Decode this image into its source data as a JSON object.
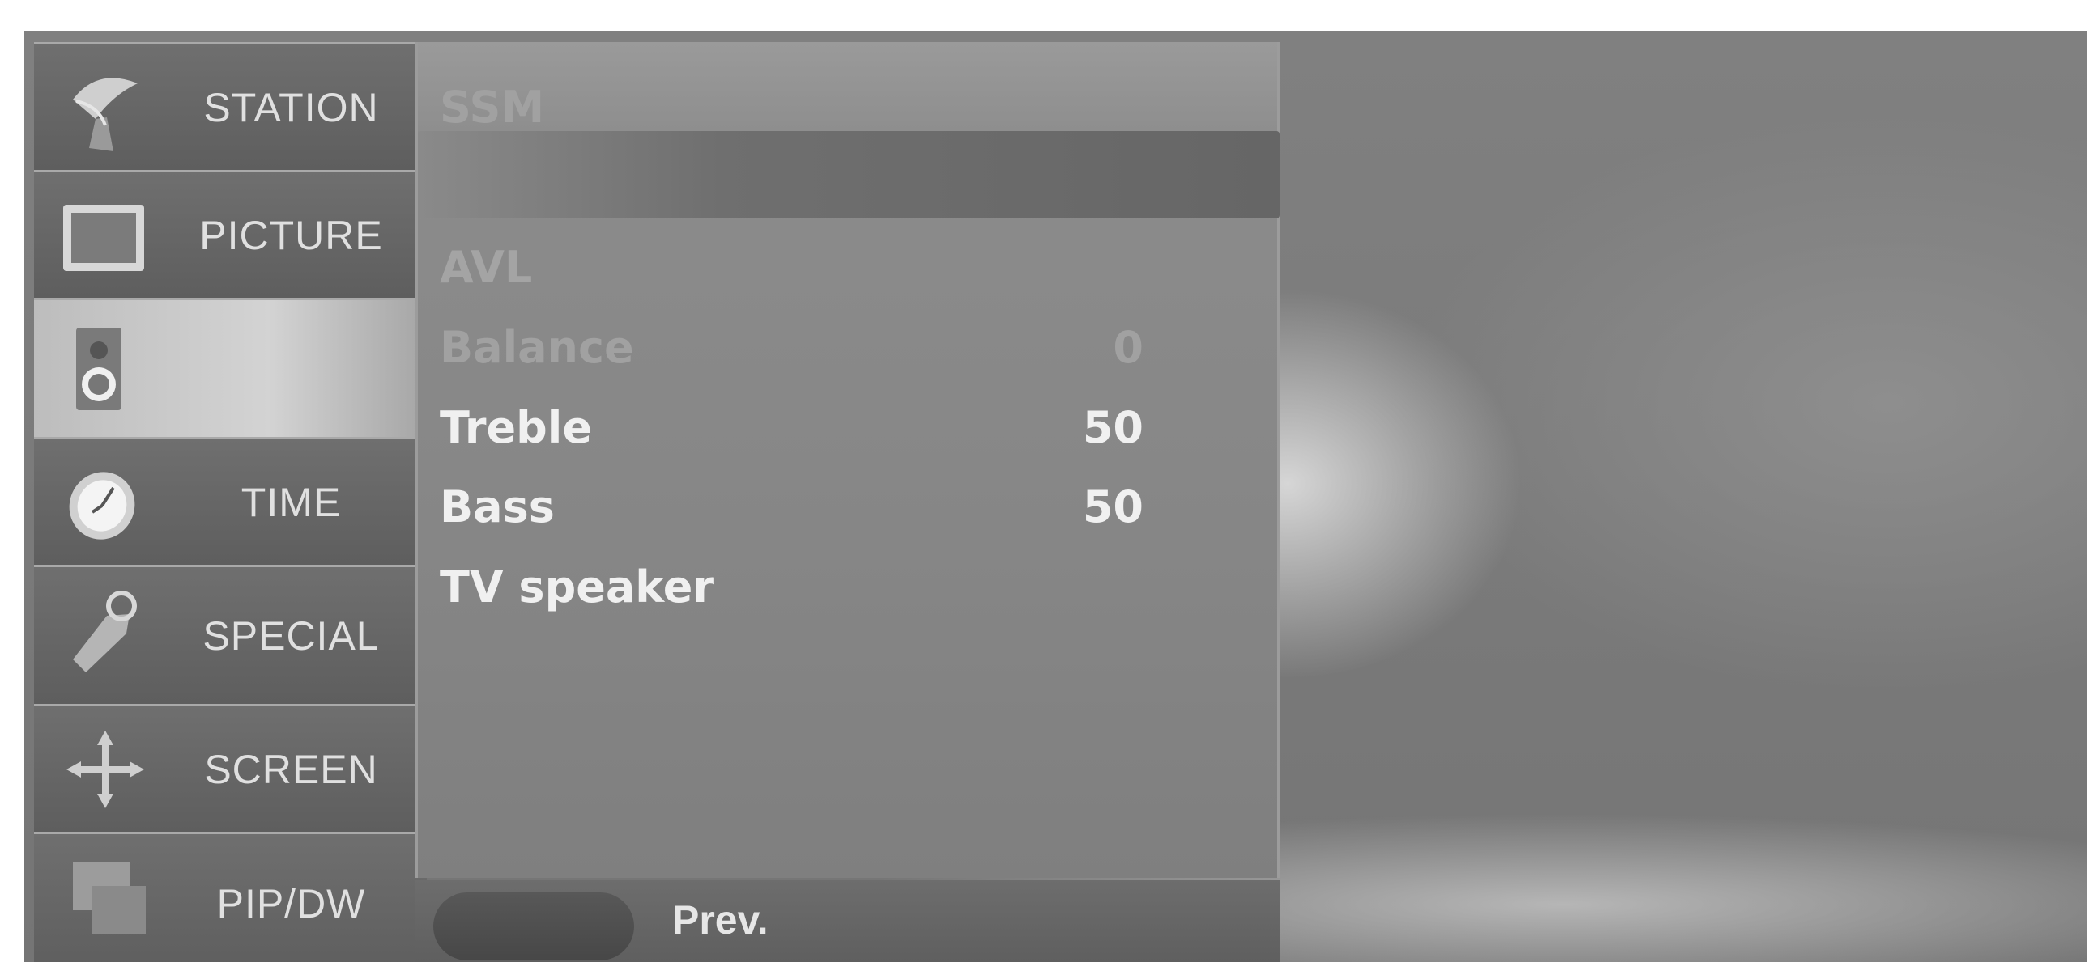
{
  "sidebar": {
    "items": [
      {
        "label": "STATION",
        "icon": "satellite-dish-icon"
      },
      {
        "label": "PICTURE",
        "icon": "tv-screen-icon"
      },
      {
        "label": "",
        "icon": "speaker-icon"
      },
      {
        "label": "TIME",
        "icon": "clock-icon"
      },
      {
        "label": "SPECIAL",
        "icon": "tag-icon"
      },
      {
        "label": "SCREEN",
        "icon": "move-arrows-icon"
      },
      {
        "label": "PIP/DW",
        "icon": "pip-window-icon"
      }
    ]
  },
  "menu": {
    "rows": [
      {
        "label": "SSM",
        "value": ""
      },
      {
        "label": "AVL",
        "value": ""
      },
      {
        "label": "Balance",
        "value": "0"
      },
      {
        "label": "Treble",
        "value": "50"
      },
      {
        "label": "Bass",
        "value": "50"
      },
      {
        "label": "TV speaker",
        "value": ""
      }
    ]
  },
  "bottom": {
    "prev_label": "Prev."
  }
}
